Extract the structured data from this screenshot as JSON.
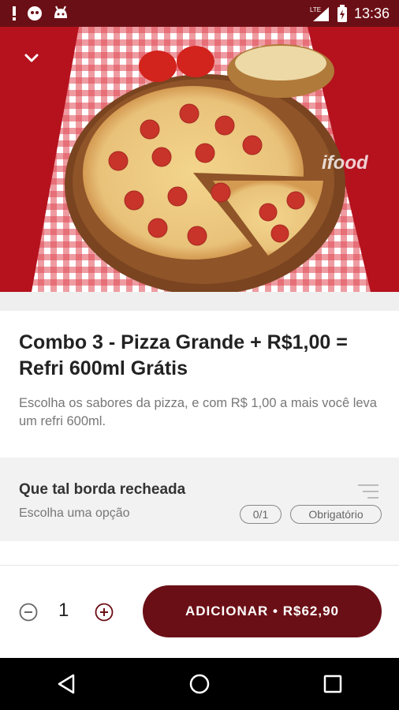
{
  "status_bar": {
    "time": "13:36",
    "network": "LTE",
    "icons": [
      "alert-icon",
      "ghost-icon",
      "android-icon",
      "signal-icon",
      "battery-icon"
    ]
  },
  "header": {
    "back_icon": "chevron-down-icon",
    "watermark": "ifood"
  },
  "product": {
    "title": "Combo 3 - Pizza Grande + R$1,00 = Refri 600ml Grátis",
    "description": "Escolha os sabores da pizza, e com R$ 1,00 a mais você leva um refri 600ml."
  },
  "option_group": {
    "title": "Que tal borda recheada",
    "subtitle": "Escolha uma opção",
    "count": "0/1",
    "required_label": "Obrigatório"
  },
  "footer": {
    "quantity": "1",
    "add_label": "ADICIONAR • R$62,90"
  },
  "colors": {
    "brand": "#6b0f16",
    "background": "#ffffff",
    "section_bg": "#f2f2f2"
  },
  "nav": {
    "icons": [
      "back-triangle-icon",
      "home-circle-icon",
      "recents-square-icon"
    ]
  }
}
